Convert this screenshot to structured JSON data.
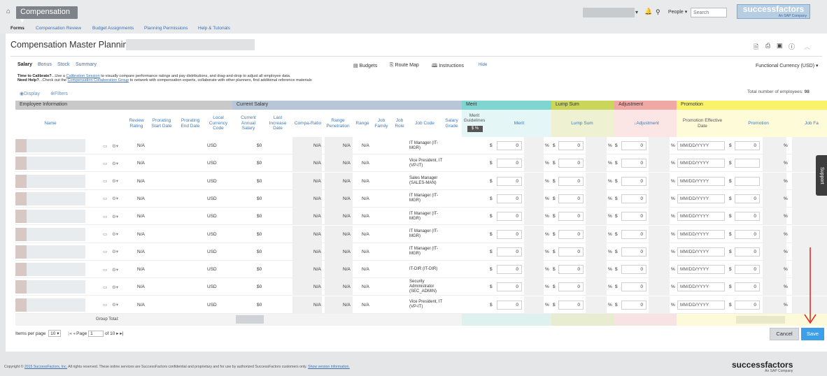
{
  "header": {
    "module": "Compensation ▾",
    "people_label": "People ▾",
    "search_placeholder": "Search",
    "brand": "successfactors",
    "brand_sub": "An SAP Company"
  },
  "nav": [
    "Forms",
    "Compensation Review",
    "Budget Assignments",
    "Planning Permissions",
    "Help & Tutorials"
  ],
  "page": {
    "title": "Compensation Master Planning",
    "sub_tabs": [
      "Salary",
      "Bonus",
      "Stock",
      "Summary"
    ],
    "toolbar": {
      "budgets": "Budgets",
      "route_map": "Route Map",
      "instructions": "Instructions",
      "hide": "Hide"
    },
    "currency": "Functional Currency (USD) ▾",
    "calibrate_title": "Time to Calibrate?",
    "calibrate_pre": "...Use a ",
    "calibrate_link": "Calibration Session",
    "calibrate_post": " to visually compare performance ratings and pay distributions, and drag-and-drop to adjust all employee data.",
    "help_title": "Need Help?",
    "help_pre": "...Check out the ",
    "help_link": "Compensation Collaboration Group",
    "help_post": " to network with compensation experts, collaborate with other planners, find additional reference materials",
    "display": "Display",
    "filters": "Filters",
    "total_label": "Total number of employees:",
    "total_value": "98"
  },
  "grid": {
    "groups": {
      "employee_info": "Employee Information",
      "current_salary": "Current Salary",
      "merit": "Merit",
      "lump_sum": "Lump Sum",
      "adjustment": "Adjustment",
      "promotion": "Promotion"
    },
    "columns": {
      "name": "Name",
      "review_rating": "Review Rating",
      "prorating_start": "Prorating Start Date",
      "prorating_end": "Prorating End Date",
      "local_currency": "Local Currency Code",
      "current_annual": "Current Annual Salary",
      "last_increase": "Last Increase Date",
      "compa_ratio": "Compa-Ratio",
      "range_pen": "Range Penetration",
      "range": "Range",
      "job_family": "Job Family",
      "job_role": "Job Role",
      "job_code": "Job Code",
      "salary_grade": "Salary Grade",
      "merit_guidelines": "Merit Guidelines",
      "merit": "Merit",
      "lump_sum": "Lump Sum",
      "adjustment": "Adjustment",
      "promo_eff": "Promotion Effective Date",
      "promotion": "Promotion",
      "job_family_trunc": "Job Fa"
    },
    "rows": [
      {
        "rating": "N/A",
        "currency": "USD",
        "salary": "$0",
        "compa": "N/A",
        "pen": "N/A",
        "range": "N/A",
        "job_code": "IT Manager (IT-MGR)",
        "merit": "0",
        "lump": "0",
        "adj": "0",
        "date": "MM/DD/YYYY",
        "promo": "0"
      },
      {
        "rating": "N/A",
        "currency": "USD",
        "salary": "$0",
        "compa": "N/A",
        "pen": "N/A",
        "range": "N/A",
        "job_code": "Vice President, IT (VP-IT)",
        "merit": "0",
        "lump": "0",
        "adj": "0",
        "date": "MM/DD/YYYY",
        "promo": ""
      },
      {
        "rating": "N/A",
        "currency": "USD",
        "salary": "$0",
        "compa": "N/A",
        "pen": "N/A",
        "range": "N/A",
        "job_code": "Sales Manager (SALES-MAN)",
        "merit": "0",
        "lump": "0",
        "adj": "0",
        "date": "MM/DD/YYYY",
        "promo": ""
      },
      {
        "rating": "N/A",
        "currency": "USD",
        "salary": "$0",
        "compa": "N/A",
        "pen": "N/A",
        "range": "N/A",
        "job_code": "IT Manager (IT-MGR)",
        "merit": "0",
        "lump": "0",
        "adj": "0",
        "date": "MM/DD/YYYY",
        "promo": "0"
      },
      {
        "rating": "N/A",
        "currency": "USD",
        "salary": "$0",
        "compa": "N/A",
        "pen": "N/A",
        "range": "N/A",
        "job_code": "IT Manager (IT-MGR)",
        "merit": "0",
        "lump": "0",
        "adj": "0",
        "date": "MM/DD/YYYY",
        "promo": "0"
      },
      {
        "rating": "N/A",
        "currency": "USD",
        "salary": "$0",
        "compa": "N/A",
        "pen": "N/A",
        "range": "N/A",
        "job_code": "IT Manager (IT-MGR)",
        "merit": "0",
        "lump": "0",
        "adj": "0",
        "date": "MM/DD/YYYY",
        "promo": "0"
      },
      {
        "rating": "N/A",
        "currency": "USD",
        "salary": "$0",
        "compa": "N/A",
        "pen": "N/A",
        "range": "N/A",
        "job_code": "IT Manager (IT-MGR)",
        "merit": "0",
        "lump": "0",
        "adj": "0",
        "date": "MM/DD/YYYY",
        "promo": "0"
      },
      {
        "rating": "N/A",
        "currency": "USD",
        "salary": "$0",
        "compa": "N/A",
        "pen": "N/A",
        "range": "N/A",
        "job_code": "IT-DIR (IT-DIR)",
        "merit": "0",
        "lump": "0",
        "adj": "0",
        "date": "MM/DD/YYYY",
        "promo": "0"
      },
      {
        "rating": "N/A",
        "currency": "USD",
        "salary": "$0",
        "compa": "N/A",
        "pen": "N/A",
        "range": "N/A",
        "job_code": "Security Administrator (SEC_ADMIN)",
        "merit": "0",
        "lump": "0",
        "adj": "0",
        "date": "MM/DD/YYYY",
        "promo": "0"
      },
      {
        "rating": "N/A",
        "currency": "USD",
        "salary": "$0",
        "compa": "N/A",
        "pen": "N/A",
        "range": "N/A",
        "job_code": "Vice President, IT (VP-IT)",
        "merit": "0",
        "lump": "0",
        "adj": "0",
        "date": "MM/DD/YYYY",
        "promo": "0"
      }
    ],
    "group_total": "Group Total:"
  },
  "pager": {
    "items_label": "Items per page",
    "items_value": "10",
    "page_label": "Page",
    "page_value": "1",
    "of": "of 10"
  },
  "buttons": {
    "cancel": "Cancel",
    "save": "Save",
    "support": "Support"
  },
  "footer": {
    "pre": "Copyright © ",
    "link1": "2015 SuccessFactors, Inc.",
    "mid": " All rights reserved. These online services are SuccessFactors confidential and proprietary and for use by authorized SuccessFactors customers only. ",
    "link2": "Show version information.",
    "brand": "successfactors",
    "brand_sub": "An SAP Company"
  },
  "colors": {
    "merit": "#7fd6d0",
    "lump_sum": "#c9d65a",
    "adjustment": "#f0a8a5",
    "promotion": "#f9f36a",
    "save": "#3c9fe7",
    "arrow": "#e02020"
  }
}
